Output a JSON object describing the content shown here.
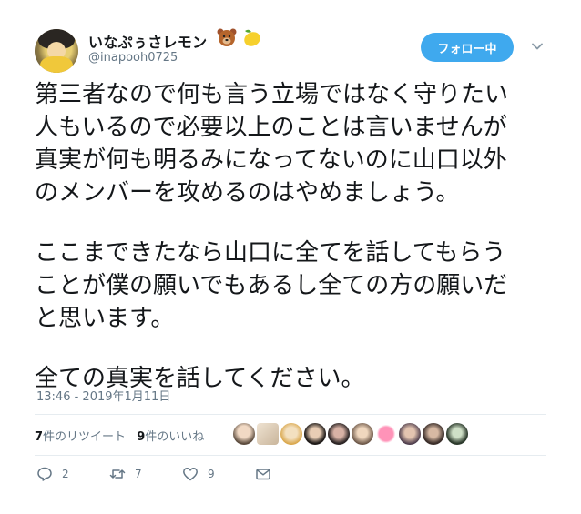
{
  "user": {
    "display_name": "いなぷぅさレモン",
    "handle": "@inapooh0725",
    "name_emojis": [
      "bear-face-icon",
      "lemon-icon"
    ]
  },
  "follow_button": {
    "label": "フォロー中"
  },
  "tweet": {
    "lines": [
      "第三者なので何も言う立場ではなく守りたい",
      "人もいるので必要以上のことは言いませんが",
      "真実が何も明るみになってないのに山口以外",
      "のメンバーを攻めるのはやめましょう。",
      "ここまできたなら山口に全てを話してもらう",
      "ことが僕の願いでもあるし全ての方の願いだ",
      "と思います。",
      "全ての真実を話してください。"
    ],
    "timestamp": "13:46 - 2019年1月11日"
  },
  "stats": {
    "retweets_count": "7",
    "retweets_label": "件のリツイート",
    "likes_count": "9",
    "likes_label": "件のいいね"
  },
  "likers_count": 10,
  "actions": {
    "reply_count": "2",
    "retweet_count": "7",
    "like_count": "9"
  },
  "colors": {
    "accent": "#3fa9ee",
    "secondary_text": "#657786",
    "primary_text": "#14171a",
    "divider": "#e6ecf0"
  }
}
